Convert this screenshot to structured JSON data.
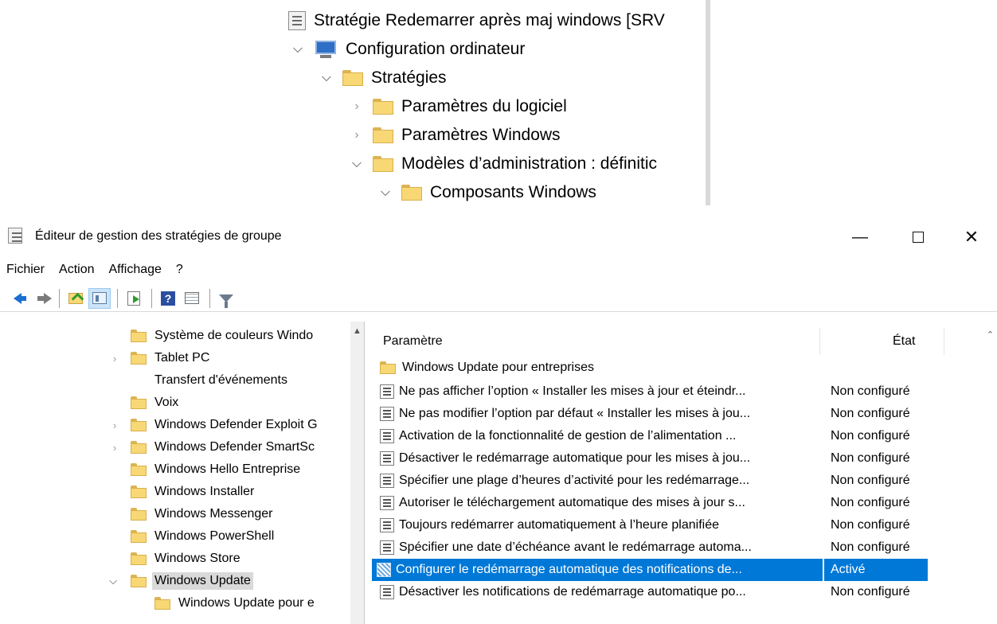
{
  "zoom_tree": {
    "root": "Stratégie Redemarrer après maj windows [SRV",
    "computer_config": "Configuration ordinateur",
    "strategies": "Stratégies",
    "software_params": "Paramètres du logiciel",
    "windows_params": "Paramètres Windows",
    "admin_models": "Modèles d’administration : définitic",
    "windows_components": "Composants Windows"
  },
  "window": {
    "title": "Éditeur de gestion des stratégies de groupe",
    "minimize": "—",
    "close": "✕"
  },
  "menu": [
    "Fichier",
    "Action",
    "Affichage",
    "?"
  ],
  "toolbar": {
    "icons": [
      "back-arrow-icon",
      "forward-arrow-icon",
      "up-folder-icon",
      "show-hide-pane-icon",
      "export-icon",
      "help-icon",
      "properties-icon",
      "filter-icon"
    ]
  },
  "left_tree": {
    "items": [
      {
        "label": "Système de couleurs Windo",
        "expander": false
      },
      {
        "label": "Tablet PC",
        "expander": true
      },
      {
        "label": "Transfert d'événements",
        "expander": false
      },
      {
        "label": "Voix",
        "expander": false
      },
      {
        "label": "Windows Defender Exploit G",
        "expander": true
      },
      {
        "label": "Windows Defender SmartSc",
        "expander": true
      },
      {
        "label": "Windows Hello Entreprise",
        "expander": false
      },
      {
        "label": "Windows Installer",
        "expander": false
      },
      {
        "label": "Windows Messenger",
        "expander": false
      },
      {
        "label": "Windows PowerShell",
        "expander": false
      },
      {
        "label": "Windows Store",
        "expander": false
      },
      {
        "label": "Windows Update",
        "expander": true,
        "expanded": true,
        "selected": true
      },
      {
        "label": "Windows Update pour e",
        "expander": false,
        "child": true
      }
    ]
  },
  "list": {
    "col_param": "Paramètre",
    "col_etat": "État",
    "folder_row": "Windows Update pour entreprises",
    "rows": [
      {
        "param": "Ne pas afficher l’option « Installer les mises à jour et éteindr...",
        "etat": "Non configuré"
      },
      {
        "param": "Ne pas modifier l’option par défaut « Installer les mises à jou...",
        "etat": "Non configuré"
      },
      {
        "param": "Activation de la fonctionnalité de gestion de l’alimentation ...",
        "etat": "Non configuré"
      },
      {
        "param": "Désactiver le redémarrage automatique pour les mises à jou...",
        "etat": "Non configuré"
      },
      {
        "param": "Spécifier une plage d’heures d’activité pour les redémarrage...",
        "etat": "Non configuré"
      },
      {
        "param": "Autoriser le téléchargement automatique des mises à jour s...",
        "etat": "Non configuré"
      },
      {
        "param": "Toujours redémarrer automatiquement à l’heure planifiée",
        "etat": "Non configuré"
      },
      {
        "param": "Spécifier une date d’échéance avant le redémarrage automa...",
        "etat": "Non configuré"
      },
      {
        "param": "Configurer le redémarrage automatique des notifications de...",
        "etat": "Activé",
        "selected": true
      },
      {
        "param": "Désactiver les notifications de redémarrage automatique po...",
        "etat": "Non configuré"
      }
    ]
  }
}
